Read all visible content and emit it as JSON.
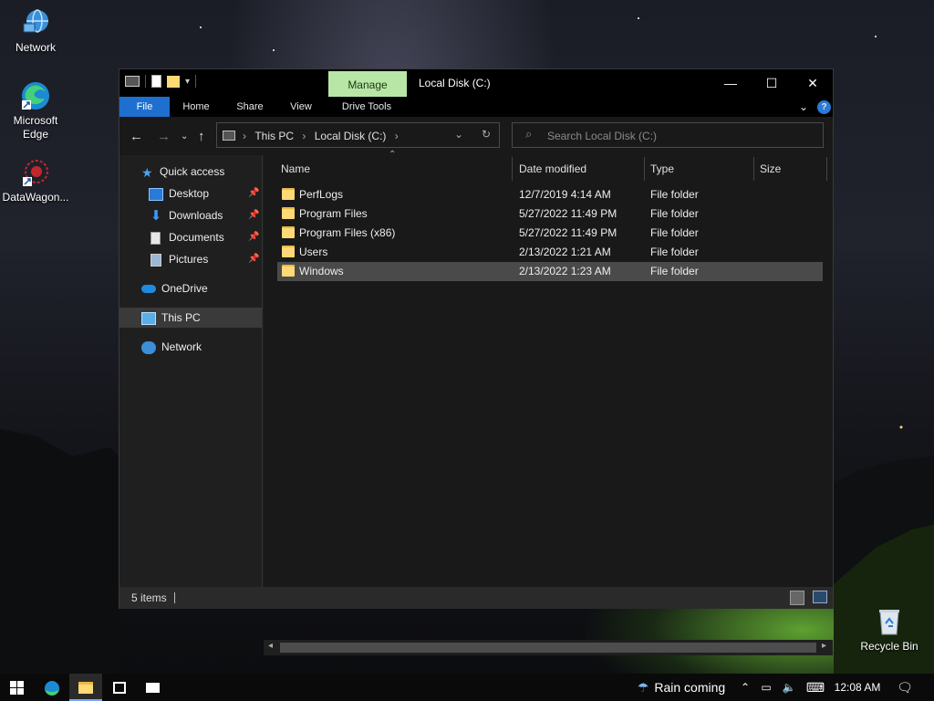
{
  "desktop": {
    "icons": [
      {
        "label": "Network",
        "icon": "network-icon"
      },
      {
        "label": "Microsoft Edge",
        "icon": "edge-icon"
      },
      {
        "label": "DataWagon...",
        "icon": "datawagon-icon"
      },
      {
        "label": "Recycle Bin",
        "icon": "recycle-bin-icon"
      }
    ]
  },
  "window": {
    "title": "Local Disk (C:)",
    "context_tab": "Manage",
    "ribbon_tabs": [
      "File",
      "Home",
      "Share",
      "View",
      "Drive Tools"
    ],
    "controls": {
      "minimize": "—",
      "maximize": "☐",
      "close": "✕",
      "help": "?"
    }
  },
  "address": {
    "crumbs": [
      "This PC",
      "Local Disk (C:)"
    ],
    "separator": "›"
  },
  "search": {
    "placeholder": "Search Local Disk (C:)"
  },
  "nav_pane": {
    "quick_access": "Quick access",
    "quick_items": [
      {
        "label": "Desktop",
        "icon": "desktop-icon",
        "pinned": true
      },
      {
        "label": "Downloads",
        "icon": "downloads-icon",
        "pinned": true
      },
      {
        "label": "Documents",
        "icon": "documents-icon",
        "pinned": true
      },
      {
        "label": "Pictures",
        "icon": "pictures-icon",
        "pinned": true
      }
    ],
    "onedrive": "OneDrive",
    "this_pc": "This PC",
    "network": "Network"
  },
  "columns": [
    "Name",
    "Date modified",
    "Type",
    "Size"
  ],
  "files": [
    {
      "name": "PerfLogs",
      "date": "12/7/2019 4:14 AM",
      "type": "File folder",
      "size": ""
    },
    {
      "name": "Program Files",
      "date": "5/27/2022 11:49 PM",
      "type": "File folder",
      "size": ""
    },
    {
      "name": "Program Files (x86)",
      "date": "5/27/2022 11:49 PM",
      "type": "File folder",
      "size": ""
    },
    {
      "name": "Users",
      "date": "2/13/2022 1:21 AM",
      "type": "File folder",
      "size": ""
    },
    {
      "name": "Windows",
      "date": "2/13/2022 1:23 AM",
      "type": "File folder",
      "size": ""
    }
  ],
  "selected_file": "Windows",
  "status": {
    "count": "5 items"
  },
  "taskbar": {
    "weather": "Rain coming",
    "time": "12:08 AM"
  },
  "colors": {
    "accent": "#1e6fd0",
    "manage_tab": "#b8e6a6",
    "folder": "#ffd975"
  }
}
